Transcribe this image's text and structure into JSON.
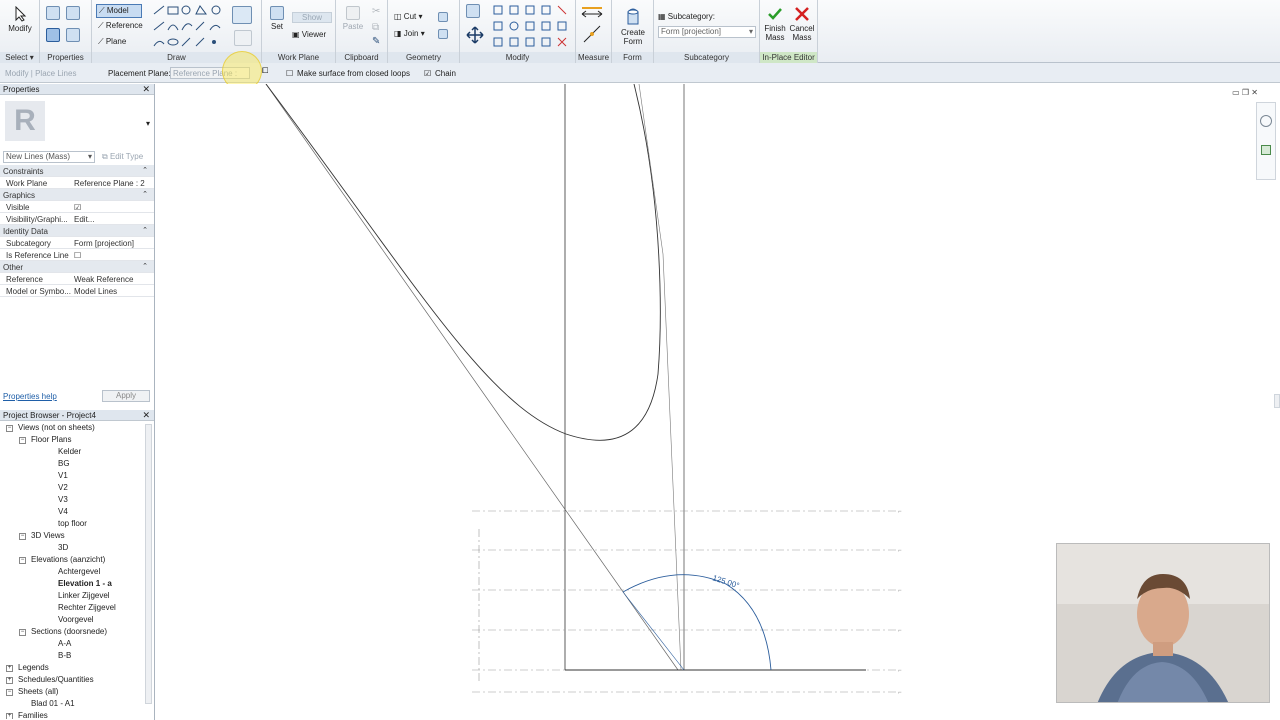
{
  "ribbon": {
    "groups": [
      {
        "name": "Select ▾"
      },
      {
        "name": "Properties"
      },
      {
        "name": "Draw"
      },
      {
        "name": "Work Plane"
      },
      {
        "name": "Clipboard"
      },
      {
        "name": "Geometry"
      },
      {
        "name": "Modify"
      },
      {
        "name": "Measure"
      },
      {
        "name": "Form"
      },
      {
        "name": "Subcategory"
      },
      {
        "name": "In-Place Editor"
      }
    ],
    "modify_label": "Modify",
    "draw_model": "Model",
    "draw_reference": "Reference",
    "draw_plane": "Plane",
    "workplane_set": "Set",
    "workplane_show": "Show",
    "workplane_viewer": "Viewer",
    "paste_label": "Paste",
    "cut_label": "Cut",
    "join_label": "Join",
    "create_form_label_1": "Create",
    "create_form_label_2": "Form",
    "subcategory_label": "Subcategory:",
    "subcategory_value": "Form [projection]",
    "finish_mass_1": "Finish",
    "finish_mass_2": "Mass",
    "cancel_mass_1": "Cancel",
    "cancel_mass_2": "Mass"
  },
  "optionsbar": {
    "context": "Modify | Place Lines",
    "placement_plane_label": "Placement Plane:",
    "placement_plane_value": "Reference Plane :",
    "make_surface_label": "Make surface from closed loops",
    "chain_label": "Chain"
  },
  "properties": {
    "title": "Properties",
    "type_name": "New Lines (Mass)",
    "edit_type": "Edit Type",
    "rows": [
      {
        "k": "Constraints",
        "v": "",
        "section": true
      },
      {
        "k": "Work Plane",
        "v": "Reference Plane : 2"
      },
      {
        "k": "Graphics",
        "v": "",
        "section": true
      },
      {
        "k": "Visible",
        "v": "☑"
      },
      {
        "k": "Visibility/Graphi...",
        "v": "Edit..."
      },
      {
        "k": "Identity Data",
        "v": "",
        "section": true
      },
      {
        "k": "Subcategory",
        "v": "Form [projection]"
      },
      {
        "k": "Is Reference Line",
        "v": "☐"
      },
      {
        "k": "Other",
        "v": "",
        "section": true
      },
      {
        "k": "Reference",
        "v": "Weak Reference"
      },
      {
        "k": "Model or Symbo...",
        "v": "Model Lines"
      }
    ],
    "help_link": "Properties help",
    "apply_label": "Apply"
  },
  "browser": {
    "title": "Project Browser - Project4",
    "items": [
      {
        "label": "Views (not on sheets)",
        "level": 0,
        "toggle": "−"
      },
      {
        "label": "Floor Plans",
        "level": 1,
        "toggle": "−"
      },
      {
        "label": "Kelder",
        "level": 2,
        "toggle": ""
      },
      {
        "label": "BG",
        "level": 2,
        "toggle": ""
      },
      {
        "label": "V1",
        "level": 2,
        "toggle": ""
      },
      {
        "label": "V2",
        "level": 2,
        "toggle": ""
      },
      {
        "label": "V3",
        "level": 2,
        "toggle": ""
      },
      {
        "label": "V4",
        "level": 2,
        "toggle": ""
      },
      {
        "label": "top floor",
        "level": 2,
        "toggle": ""
      },
      {
        "label": "3D Views",
        "level": 1,
        "toggle": "−"
      },
      {
        "label": "3D",
        "level": 2,
        "toggle": ""
      },
      {
        "label": "Elevations (aanzicht)",
        "level": 1,
        "toggle": "−"
      },
      {
        "label": "Achtergevel",
        "level": 2,
        "toggle": ""
      },
      {
        "label": "Elevation 1 - a",
        "level": 2,
        "toggle": "",
        "bold": true
      },
      {
        "label": "Linker Zijgevel",
        "level": 2,
        "toggle": ""
      },
      {
        "label": "Rechter Zijgevel",
        "level": 2,
        "toggle": ""
      },
      {
        "label": "Voorgevel",
        "level": 2,
        "toggle": ""
      },
      {
        "label": "Sections (doorsnede)",
        "level": 1,
        "toggle": "−"
      },
      {
        "label": "A-A",
        "level": 2,
        "toggle": ""
      },
      {
        "label": "B-B",
        "level": 2,
        "toggle": ""
      },
      {
        "label": "Legends",
        "level": 0,
        "toggle": "+"
      },
      {
        "label": "Schedules/Quantities",
        "level": 0,
        "toggle": "+"
      },
      {
        "label": "Sheets (all)",
        "level": 0,
        "toggle": "−"
      },
      {
        "label": "Blad 01 - A1",
        "level": 1,
        "toggle": ""
      },
      {
        "label": "Families",
        "level": 0,
        "toggle": "+"
      }
    ]
  },
  "canvas": {
    "dimension_text": "125.00°"
  },
  "colors": {
    "accent": "#1f5fa8",
    "finish_check": "#2a9d2a",
    "cancel_x": "#d42020",
    "dimension_blue": "#2b5d9c"
  }
}
